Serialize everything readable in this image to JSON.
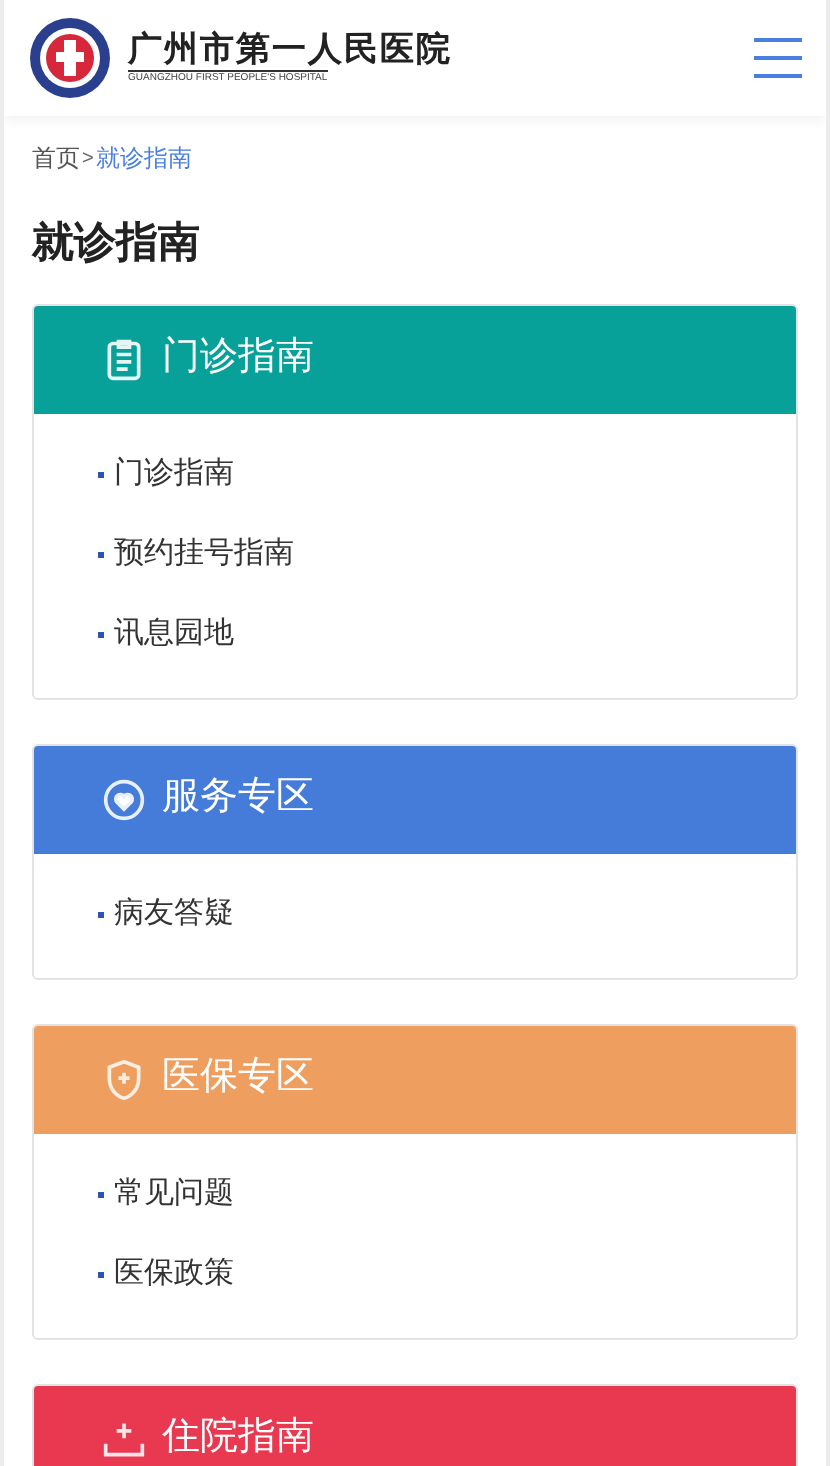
{
  "header": {
    "logo_title": "广州市第一人民医院",
    "logo_subtitle": "GUANGZHOU FIRST PEOPLE'S HOSPITAL"
  },
  "breadcrumb": [
    {
      "label": "首页",
      "selected": false
    },
    {
      "label": "就诊指南",
      "selected": true
    }
  ],
  "breadcrumb_separator": ">",
  "page_title": "就诊指南",
  "sections": [
    {
      "title": "门诊指南",
      "kind": "clipboard",
      "color": "#07a19a",
      "links": [
        "门诊指南",
        "预约挂号指南",
        "讯息园地"
      ]
    },
    {
      "title": "服务专区",
      "kind": "heart",
      "color": "#457bd9",
      "links": [
        "病友答疑"
      ]
    },
    {
      "title": "医保专区",
      "kind": "shield",
      "color": "#ee9e5f",
      "links": [
        "常见问题",
        "医保政策"
      ]
    },
    {
      "title": "住院指南",
      "kind": "bed",
      "color": "#e83951"
    }
  ]
}
